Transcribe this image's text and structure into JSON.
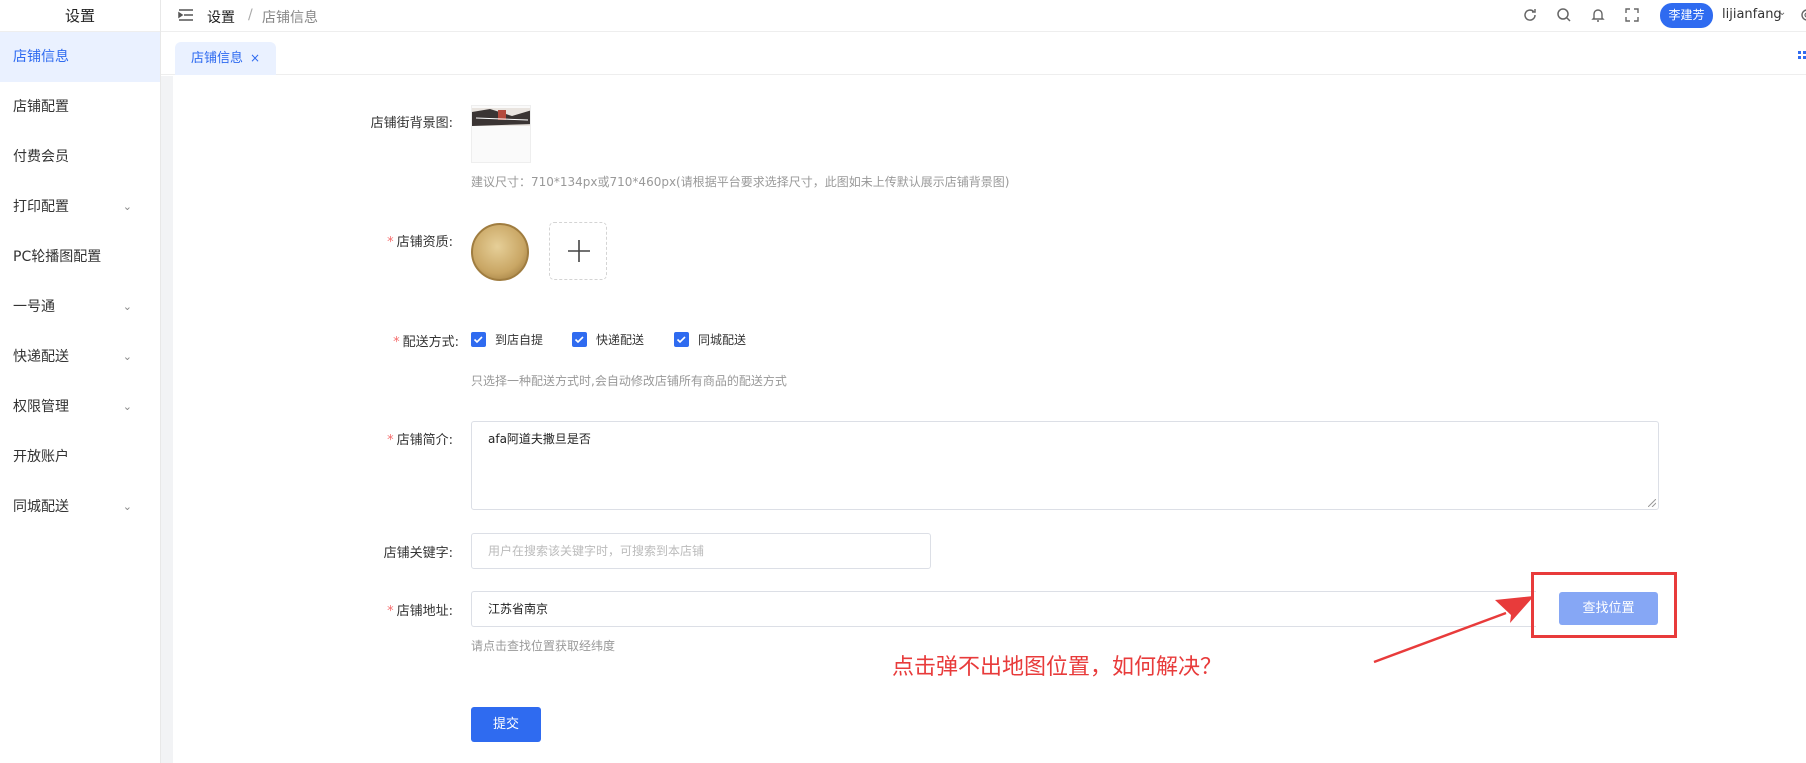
{
  "sidebar": {
    "title": "设置",
    "items": [
      {
        "label": "店铺信息",
        "expandable": false,
        "active": true
      },
      {
        "label": "店铺配置",
        "expandable": false
      },
      {
        "label": "付费会员",
        "expandable": false
      },
      {
        "label": "打印配置",
        "expandable": true
      },
      {
        "label": "PC轮播图配置",
        "expandable": false
      },
      {
        "label": "一号通",
        "expandable": true
      },
      {
        "label": "快递配送",
        "expandable": true
      },
      {
        "label": "权限管理",
        "expandable": true
      },
      {
        "label": "开放账户",
        "expandable": false
      },
      {
        "label": "同城配送",
        "expandable": true
      }
    ]
  },
  "header": {
    "breadcrumb_root": "设置",
    "breadcrumb_sep": "/",
    "breadcrumb_current": "店铺信息",
    "user_badge": "李建芳",
    "username": "lijianfang"
  },
  "tabs": {
    "active_label": "店铺信息",
    "close_glyph": "×"
  },
  "form": {
    "bg_label": "店铺街背景图:",
    "bg_hint": "建议尺寸：710*134px或710*460px(请根据平台要求选择尺寸，此图如未上传默认展示店铺背景图)",
    "qual_label": "店铺资质:",
    "delivery_label": "配送方式:",
    "delivery_options": [
      "到店自提",
      "快递配送",
      "同城配送"
    ],
    "delivery_hint": "只选择一种配送方式时,会自动修改店铺所有商品的配送方式",
    "intro_label": "店铺简介:",
    "intro_value": "afa阿道夫撒旦是否",
    "keyword_label": "店铺关键字:",
    "keyword_placeholder": "用户在搜索该关键字时，可搜索到本店铺",
    "address_label": "店铺地址:",
    "address_value": "江苏省南京",
    "find_button": "查找位置",
    "address_hint": "请点击查找位置获取经纬度",
    "submit_button": "提交",
    "required_mark": "*"
  },
  "annotation": {
    "text": "点击弹不出地图位置，如何解决？"
  },
  "colors": {
    "primary": "#2f6bf0",
    "annotation_red": "#e83b3b",
    "active_bg": "#eaf1ff"
  },
  "icons": {
    "menu": "menu-fold-icon",
    "refresh": "refresh-icon",
    "search": "search-icon",
    "bell": "bell-icon",
    "fullscreen": "fullscreen-icon",
    "gear": "gear-icon",
    "plus": "plus-icon",
    "check": "check-icon",
    "close": "close-icon",
    "chevron": "chevron-down-icon"
  }
}
